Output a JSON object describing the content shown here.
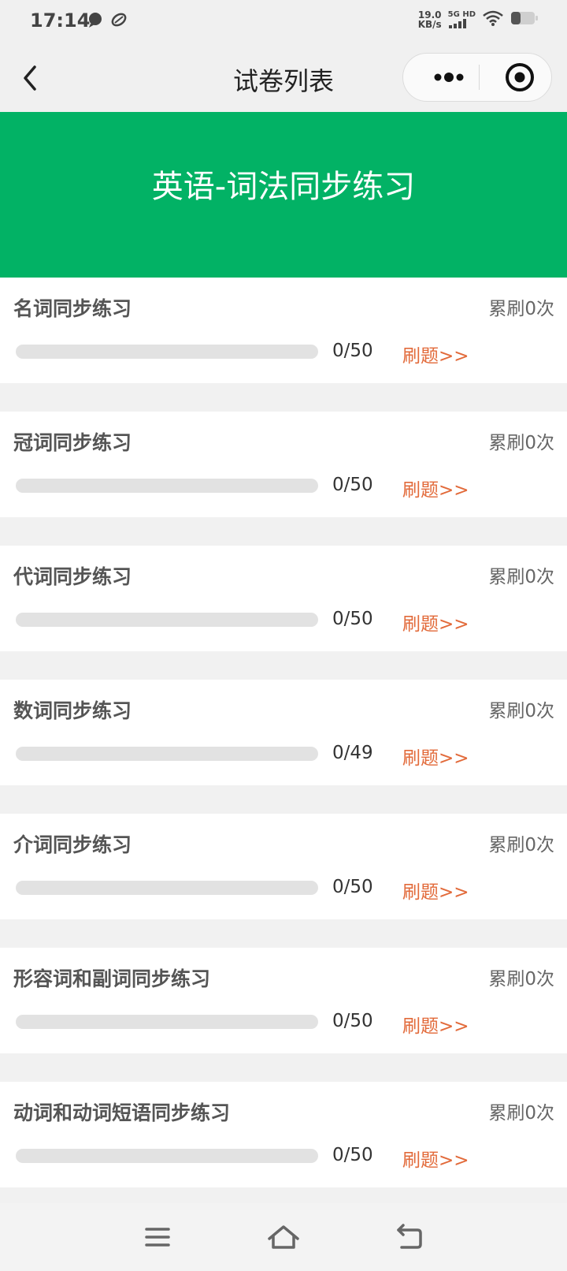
{
  "status_bar": {
    "time": "17:14",
    "net_speed_value": "19.0",
    "net_speed_unit": "KB/s",
    "signal_label": "5G HD",
    "icons": [
      "chat-bubble-icon",
      "rugby-icon",
      "signal-icon",
      "wifi-icon",
      "battery-icon"
    ]
  },
  "nav": {
    "title": "试卷列表",
    "icons": [
      "back-chevron-icon",
      "more-dots-icon",
      "target-close-icon"
    ]
  },
  "banner": {
    "title": "英语-词法同步练习",
    "color": "#02b265"
  },
  "items": [
    {
      "title": "名词同步练习",
      "count_text": "累刷0次",
      "progress_text": "0/50",
      "done": 0,
      "total": 50,
      "action": "刷题>>"
    },
    {
      "title": "冠词同步练习",
      "count_text": "累刷0次",
      "progress_text": "0/50",
      "done": 0,
      "total": 50,
      "action": "刷题>>"
    },
    {
      "title": "代词同步练习",
      "count_text": "累刷0次",
      "progress_text": "0/50",
      "done": 0,
      "total": 50,
      "action": "刷题>>"
    },
    {
      "title": "数词同步练习",
      "count_text": "累刷0次",
      "progress_text": "0/49",
      "done": 0,
      "total": 49,
      "action": "刷题>>"
    },
    {
      "title": "介词同步练习",
      "count_text": "累刷0次",
      "progress_text": "0/50",
      "done": 0,
      "total": 50,
      "action": "刷题>>"
    },
    {
      "title": "形容词和副词同步练习",
      "count_text": "累刷0次",
      "progress_text": "0/50",
      "done": 0,
      "total": 50,
      "action": "刷题>>"
    },
    {
      "title": "动词和动词短语同步练习",
      "count_text": "累刷0次",
      "progress_text": "0/50",
      "done": 0,
      "total": 50,
      "action": "刷题>>"
    }
  ],
  "colors": {
    "accent": "#02b265",
    "action": "#e26a3a",
    "track": "#e2e2e2"
  },
  "bottom_nav": {
    "icons": [
      "menu-icon",
      "home-icon",
      "back-icon"
    ]
  }
}
